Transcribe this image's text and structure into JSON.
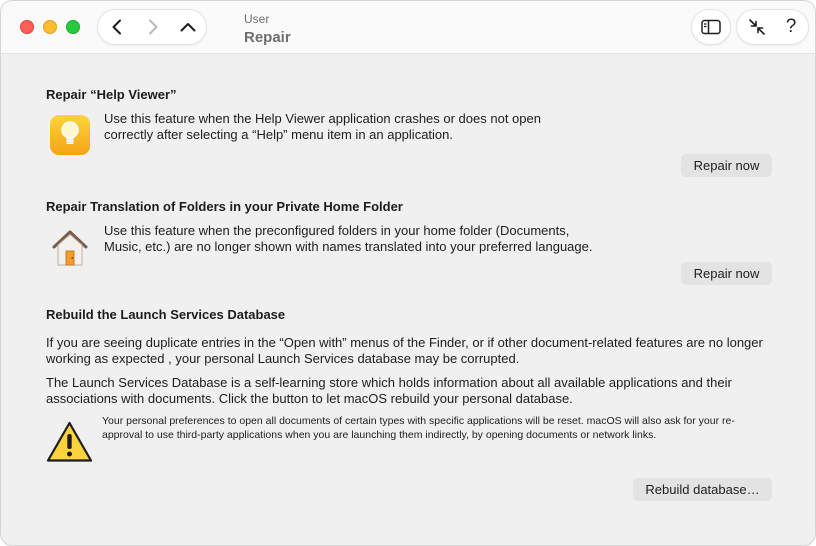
{
  "header": {
    "subtitle": "User",
    "title": "Repair"
  },
  "sections": {
    "help_viewer": {
      "title": "Repair “Help Viewer”",
      "description": "Use this feature when the Help Viewer application crashes or does not open correctly after selecting a “Help” menu item in an application.",
      "button": "Repair now",
      "icon": "lightbulb-icon"
    },
    "translation": {
      "title": "Repair Translation of Folders in your Private Home Folder",
      "description": "Use this feature when the preconfigured folders in your home folder (Documents, Music, etc.) are no longer shown with names translated into your preferred language.",
      "button": "Repair now",
      "icon": "home-icon"
    },
    "launch_services": {
      "title": "Rebuild the Launch Services Database",
      "paragraph1": "If you are seeing duplicate entries in the “Open with” menus of the Finder, or if other document-related features are no longer working as expected , your personal Launch Services database may be corrupted.",
      "paragraph2": "The Launch Services Database is a self-learning store which holds information about all available applications and their associations with documents. Click the button to let macOS rebuild your personal database.",
      "warning": "Your personal preferences to open all documents of certain types with specific applications will be reset. macOS will also ask for your re-approval to use third-party applications when you are launching them indirectly, by opening documents or network links.",
      "button": "Rebuild database…",
      "icon": "warning-icon"
    }
  },
  "colors": {
    "close": "#ff5f57",
    "minimize": "#febc2e",
    "zoom": "#28c840",
    "window_bg": "#f0f0f0",
    "button_bg": "#e3e3e3"
  }
}
